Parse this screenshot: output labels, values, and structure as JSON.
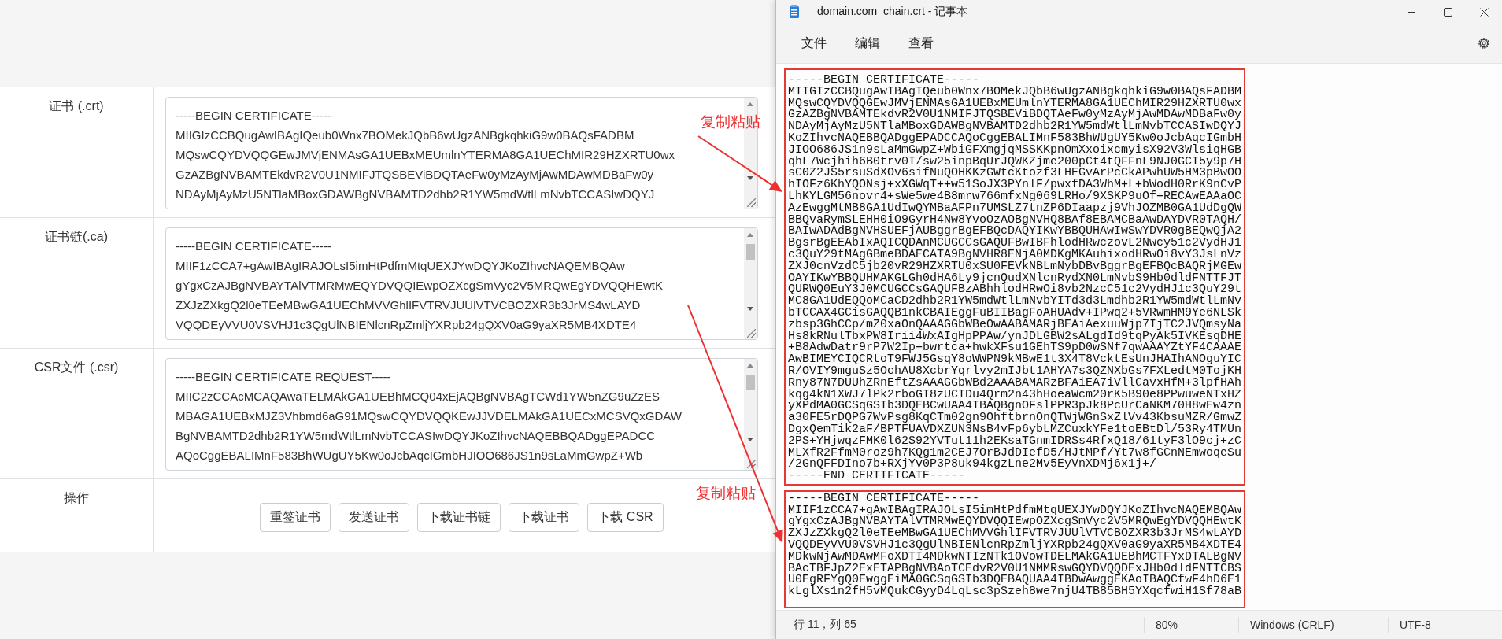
{
  "form": {
    "rows": [
      {
        "kind": "text",
        "label": "证书 (.crt)",
        "lines": [
          "-----BEGIN CERTIFICATE-----",
          "MIIGIzCCBQugAwIBAgIQeub0Wnx7BOMekJQbB6wUgzANBgkqhkiG9w0BAQsFADBM",
          "MQswCQYDVQQGEwJMVjENMAsGA1UEBxMEUmlnYTERMA8GA1UEChMIR29HZXRTU0wx",
          "GzAZBgNVBAMTEkdvR2V0U1NMIFJTQSBEViBDQTAeFw0yMzAyMjAwMDAwMDBaFw0y",
          "NDAyMjAyMzU5NTlaMBoxGDAWBgNVBAMTD2dhb2R1YW5mdWtlLmNvbTCCASIwDQYJ"
        ]
      },
      {
        "kind": "text",
        "label": "证书链(.ca)",
        "lines": [
          "-----BEGIN CERTIFICATE-----",
          "MIIF1zCCA7+gAwIBAgIRAJOLsI5imHtPdfmMtqUEXJYwDQYJKoZIhvcNAQEMBQAw",
          "gYgxCzAJBgNVBAYTAlVTMRMwEQYDVQQIEwpOZXcgSmVyc2V5MRQwEgYDVQQHEwtK",
          "ZXJzZXkgQ2l0eTEeMBwGA1UEChMVVGhlIFVTRVJUUlVTVCBOZXR3b3JrMS4wLAYD",
          "VQQDEyVVU0VSVHJ1c3QgUlNBIENlcnRpZmljYXRpb24gQXV0aG9yaXR5MB4XDTE4"
        ]
      },
      {
        "kind": "text",
        "label": "CSR文件 (.csr)",
        "lines": [
          "-----BEGIN CERTIFICATE REQUEST-----",
          "MIIC2zCCAcMCAQAwaTELMAkGA1UEBhMCQ04xEjAQBgNVBAgTCWd1YW5nZG9uZzES",
          "MBAGA1UEBxMJZ3Vhbmd6aG91MQswCQYDVQQKEwJJVDELMAkGA1UECxMCSVQxGDAW",
          "BgNVBAMTD2dhb2R1YW5mdWtlLmNvbTCCASIwDQYJKoZIhvcNAQEBBQADggEPADCC",
          "AQoCggEBALIMnF583BhWUgUY5Kw0oJcbAqcIGmbHJIOO686JS1n9sLaMmGwpZ+Wb"
        ]
      },
      {
        "kind": "actions",
        "label": "操作",
        "buttons": [
          "重签证书",
          "发送证书",
          "下载证书链",
          "下载证书",
          "下载 CSR"
        ]
      }
    ]
  },
  "notepad": {
    "title": "domain.com_chain.crt - 记事本",
    "menu": [
      "文件",
      "编辑",
      "查看"
    ],
    "blocks": [
      {
        "lines": [
          "-----BEGIN CERTIFICATE-----",
          "MIIGIzCCBQugAwIBAgIQeub0Wnx7BOMekJQbB6wUgzANBgkqhkiG9w0BAQsFADBM",
          "MQswCQYDVQQGEwJMVjENMAsGA1UEBxMEUmlnYTERMA8GA1UEChMIR29HZXRTU0wx",
          "GzAZBgNVBAMTEkdvR2V0U1NMIFJTQSBEViBDQTAeFw0yMzAyMjAwMDAwMDBaFw0y",
          "NDAyMjAyMzU5NTlaMBoxGDAWBgNVBAMTD2dhb2R1YW5mdWtlLmNvbTCCASIwDQYJ",
          "KoZIhvcNAQEBBQADggEPADCCAQoCggEBALIMnF583BhWUgUY5Kw0oJcbAqcIGmbH",
          "JIOO686JS1n9sLaMmGwpZ+WbiGFXmgjqMSSKKpnOmXxoixcmyisX92V3WlsiqHGB",
          "qhL7Wcjhih6B0trv0I/sw25inpBqUrJQWKZjme200pCt4tQFFnL9NJ0GCI5y9p7H",
          "sC0Z2JS5rsuSdXOv6sifNuQOHKKzGWtcKtozf3LHEGvArPcCkAPwhUW5HM3pBwOO",
          "hIOFz6KhYQONsj+xXGWqT++w51SoJX3PYnlF/pwxfDA3WhM+L+bWodH0RrK9nCvP",
          "LhKYLGM56novr4+sWe5we4B8mrw766mfxNg069LRHo/9XSKP9uOf+RECAwEAAaOC",
          "AzEwggMtMB8GA1UdIwQYMBaAFPn7UMSLZ7tnZP6DIaapzj9VhJOZMB0GA1UdDgQW",
          "BBQvaRymSLEHH0iO9GyrH4Nw8YvoOzAOBgNVHQ8BAf8EBAMCBaAwDAYDVR0TAQH/",
          "BAIwADAdBgNVHSUEFjAUBggrBgEFBQcDAQYIKwYBBQUHAwIwSwYDVR0gBEQwQjA2",
          "BgsrBgEEAbIxAQICQDAnMCUGCCsGAQUFBwIBFhlodHRwczovL2Nwcy51c2VydHJ1",
          "c3QuY29tMAgGBmeBDAECATA9BgNVHR8ENjA0MDKgMKAuhixodHRwOi8vY3JsLnVz",
          "ZXJ0cnVzdC5jb20vR29HZXRTU0xSU0FEVkNBLmNybDBvBggrBgEFBQcBAQRjMGEw",
          "OAYIKwYBBQUHMAKGLGh0dHA6Ly9jcnQudXNlcnRydXN0LmNvbS9Hb0dldFNTTFJT",
          "QURWQ0EuY3J0MCUGCCsGAQUFBzABhhlodHRwOi8vb2NzcC51c2VydHJ1c3QuY29t",
          "MC8GA1UdEQQoMCaCD2dhb2R1YW5mdWtlLmNvbYITd3d3Lmdhb2R1YW5mdWtlLmNv",
          "bTCCAX4GCisGAQQB1nkCBAIEggFuBIIBagFoAHUAdv+IPwq2+5VRwmHM9Ye6NLSk",
          "zbsp3GhCCp/mZ0xaOnQAAAGGbWBeOwAABAMARjBEAiAexuuWjp7IjTC2JVQmsyNa",
          "Hs8kRNulTbxPW8Irii4WxAIgHpPPAw/ynJDLGBW2sALgdId9tqPyAk5IVKEsqDHE",
          "+B8AdwDatr9rP7W2Ip+bwrtca+hwkXFsu1GEhTS9pD0wSNf7qwAAAYZtYF4CAAAE",
          "AwBIMEYCIQCRtoT9FWJ5GsqY8oWWPN9kMBwE1t3X4T8VcktEsUnJHAIhANOguYIC",
          "R/OVIY9mguSz5OchAU8XcbrYqrlvy2mIJbt1AHYA7s3QZNXbGs7FXLedtM0TojKH",
          "Rny87N7DUUhZRnEftZsAAAGGbWBd2AAABAMARzBFAiEA7iVllCavxHfM+3lpfHAh",
          "kqg4kN1XWJ7lPk2rboGI8zUCIDu4Qrm2n43hHoeaWcm20rK5B90e8PPwuweNTxHZ",
          "yXPdMA0GCSqGSIb3DQEBCwUAA4IBAQBgnOFslPPR3pJk8PcUrCaNKM70H8wEw4zn",
          "a30FE5rDQPG7WvPsg8KqCTm02gn9OhftbrnOnQTWjWGnSxZlVv43KbsuMZR/GmwZ",
          "DgxQemTik2aF/BPTFUAVDXZUN3NsB4vFp6ybLMZCuxkYFe1toEBtDl/53Ry4TMUn",
          "2PS+YHjwqzFMK0l62S92YVTut11h2EKsaTGnmIDRSs4RfxQ18/61tyF3lO9cj+zC",
          "MLXfR2FfmM0roz9h7KQg1m2CEJ7OrBJdDIefD5/HJtMPf/Yt7w8fGCnNEmwoqeSu",
          "/2GnQFFDIno7b+RXjYv0P3P8uk94kgzLne2Mv5EyVnXDMj6x1j+/",
          "-----END CERTIFICATE-----"
        ]
      },
      {
        "lines": [
          "-----BEGIN CERTIFICATE-----",
          "MIIF1zCCA7+gAwIBAgIRAJOLsI5imHtPdfmMtqUEXJYwDQYJKoZIhvcNAQEMBQAw",
          "gYgxCzAJBgNVBAYTAlVTMRMwEQYDVQQIEwpOZXcgSmVyc2V5MRQwEgYDVQQHEwtK",
          "ZXJzZXkgQ2l0eTEeMBwGA1UEChMVVGhlIFVTRVJUUlVTVCBOZXR3b3JrMS4wLAYD",
          "VQQDEyVVU0VSVHJ1c3QgUlNBIENlcnRpZmljYXRpb24gQXV0aG9yaXR5MB4XDTE4",
          "MDkwNjAwMDAwMFoXDTI4MDkwNTIzNTk1OVowTDELMAkGA1UEBhMCTFYxDTALBgNV",
          "BAcTBFJpZ2ExETAPBgNVBAoTCEdvR2V0U1NMMRswGQYDVQQDExJHb0dldFNTTCBS",
          "U0EgRFYgQ0EwggEiMA0GCSqGSIb3DQEBAQUAA4IBDwAwggEKAoIBAQCfwF4hD6E1",
          "kLglXs1n2fH5vMQukCGyyD4LqLsc3pSzeh8we7njU4TB85BH5YXqcfwiH1Sf78aB"
        ]
      }
    ],
    "status": [
      "行 11，列 65",
      "80%",
      "Windows (CRLF)",
      "UTF-8"
    ]
  },
  "annotations": [
    {
      "text": "复制粘贴"
    },
    {
      "text": "复制粘贴"
    }
  ]
}
